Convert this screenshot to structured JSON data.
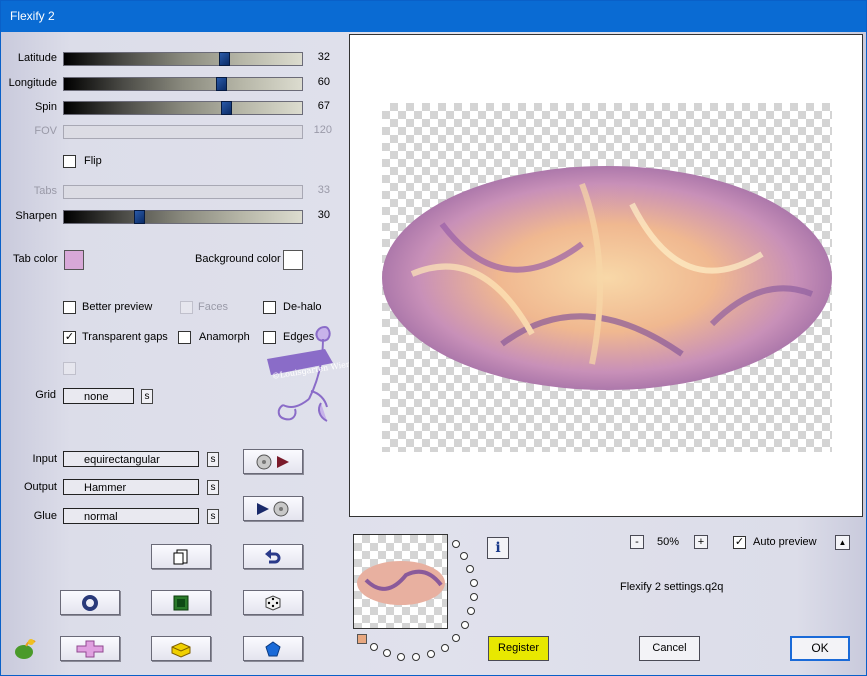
{
  "window": {
    "title": "Flexify 2"
  },
  "sliders": [
    {
      "label": "Latitude",
      "value": "32",
      "enabled": true,
      "level": 0.67
    },
    {
      "label": "Longitude",
      "value": "60",
      "enabled": true,
      "level": 0.66
    },
    {
      "label": "Spin",
      "value": "67",
      "enabled": true,
      "level": 0.68
    },
    {
      "label": "FOV",
      "value": "120",
      "enabled": false
    },
    {
      "label": "Tabs",
      "value": "33",
      "enabled": false
    },
    {
      "label": "Sharpen",
      "value": "30",
      "enabled": true,
      "level": 0.31
    }
  ],
  "flip": {
    "label": "Flip",
    "checked": false
  },
  "tab_color": {
    "label": "Tab color",
    "color": "#d8a8d8"
  },
  "background_color": {
    "label": "Background color",
    "color": "#ffffff"
  },
  "options": {
    "better_preview": {
      "label": "Better preview",
      "checked": false
    },
    "faces": {
      "label": "Faces",
      "checked": false,
      "enabled": false
    },
    "de_halo": {
      "label": "De-halo",
      "checked": false
    },
    "transparent_gaps": {
      "label": "Transparent gaps",
      "checked": true
    },
    "anamorph": {
      "label": "Anamorph",
      "checked": false
    },
    "edges": {
      "label": "Edges",
      "checked": false
    }
  },
  "grid": {
    "label": "Grid",
    "value": "none",
    "s": "s"
  },
  "input": {
    "label": "Input",
    "value": "equirectangular",
    "s": "s"
  },
  "output": {
    "label": "Output",
    "value": "Hammer",
    "s": "s"
  },
  "glue": {
    "label": "Glue",
    "value": "normal",
    "s": "s"
  },
  "watermark": {
    "text": "©Louisgarten Wien"
  },
  "zoom": {
    "minus": "-",
    "value": "50%",
    "plus": "+"
  },
  "auto_preview": {
    "label": "Auto preview",
    "checked": true,
    "arrow": "▲"
  },
  "settings_file": "Flexify 2 settings.q2q",
  "buttons": {
    "register": "Register",
    "cancel": "Cancel",
    "ok": "OK"
  },
  "info_glyph": "i",
  "colors": {
    "titlebar": "#0a6bd3",
    "register": "#e8e800",
    "thumb": "#1a3f80"
  },
  "icons": [
    "preset-play-icon",
    "play-preset-icon",
    "page-copy-icon",
    "undo-icon",
    "ring-icon",
    "square-icon",
    "dice-icon",
    "cross-icon",
    "yellow-block-icon",
    "pentagon-icon",
    "logo-icon",
    "info-icon"
  ]
}
